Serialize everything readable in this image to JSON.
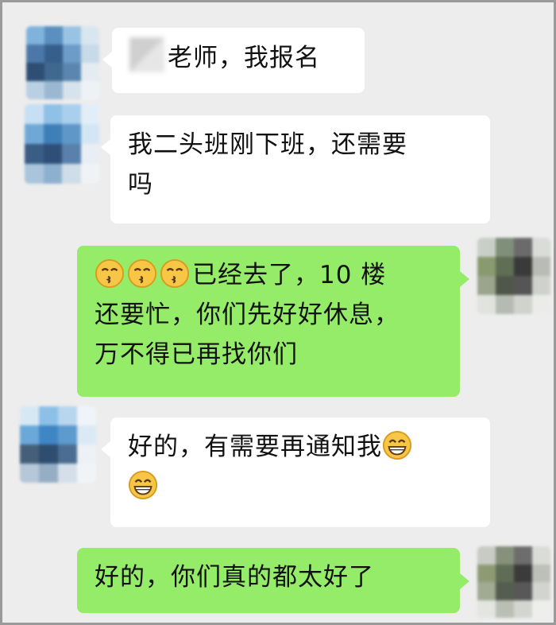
{
  "messages": [
    {
      "side": "in",
      "name_label": "老师，我报名"
    },
    {
      "side": "in",
      "line1": "我二头班刚下班，还需要",
      "line2": "吗"
    },
    {
      "side": "out",
      "line1_text": "已经去了，10 楼",
      "line2": "还要忙，你们先好好休息，",
      "line3": "万不得已再找你们",
      "emojis": [
        "kissing-smiling-eyes-emoji",
        "kissing-smiling-eyes-emoji",
        "kissing-smiling-eyes-emoji"
      ]
    },
    {
      "side": "in",
      "line1": "好的，有需要再通知我",
      "emojis": [
        "grinning-emoji",
        "grinning-emoji"
      ]
    },
    {
      "side": "out",
      "line1": "好的，你们真的都太好了"
    }
  ],
  "colors": {
    "background": "#ededed",
    "incoming_bubble": "#ffffff",
    "outgoing_bubble": "#95ec69"
  }
}
